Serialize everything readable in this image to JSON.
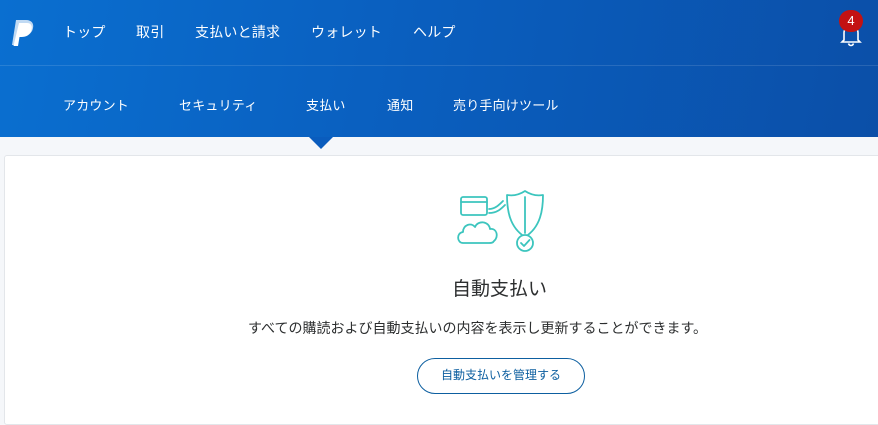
{
  "top_nav": {
    "items": [
      {
        "label": "トップ"
      },
      {
        "label": "取引"
      },
      {
        "label": "支払いと請求"
      },
      {
        "label": "ウォレット"
      },
      {
        "label": "ヘルプ"
      }
    ],
    "notification_count": "4"
  },
  "sub_nav": {
    "items": [
      {
        "label": "アカウント"
      },
      {
        "label": "セキュリティ"
      },
      {
        "label": "支払い",
        "active": true
      },
      {
        "label": "通知"
      },
      {
        "label": "売り手向けツール"
      }
    ]
  },
  "main": {
    "title": "自動支払い",
    "description": "すべての購読および自動支払いの内容を表示し更新することができます。",
    "manage_button": "自動支払いを管理する"
  },
  "colors": {
    "header_blue": "#0a5fbf",
    "badge_red": "#c31212",
    "illustration_teal": "#3cc5be",
    "button_blue": "#0d5fa0"
  },
  "icons": [
    "paypal-logo",
    "bell-icon",
    "card-cloud-shield-illustration"
  ]
}
